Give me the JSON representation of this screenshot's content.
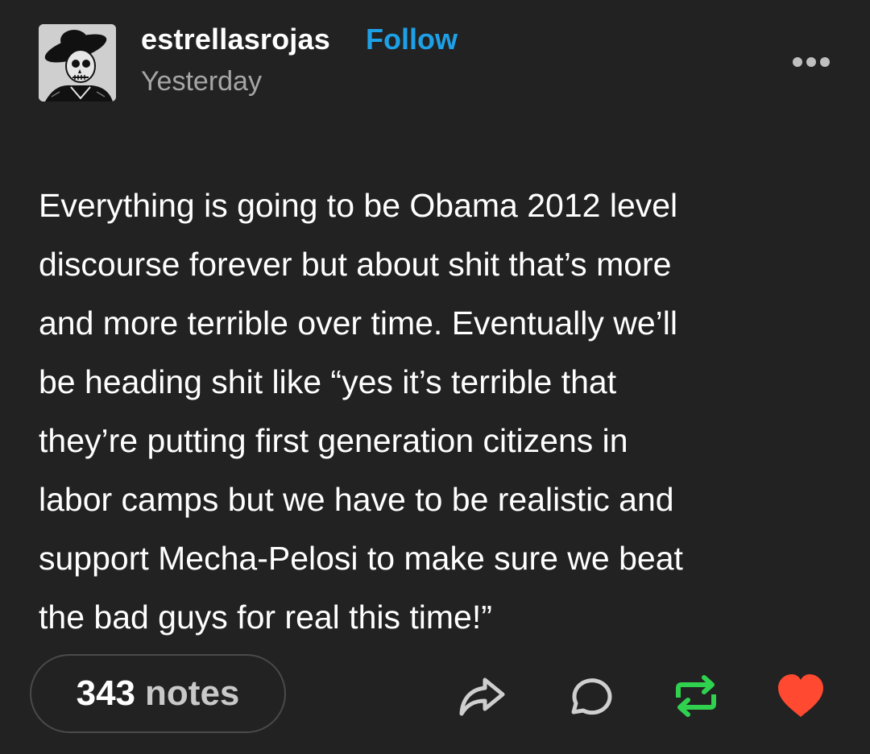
{
  "post": {
    "username": "estrellasrojas",
    "follow_label": "Follow",
    "timestamp": "Yesterday",
    "more_icon": "more-horizontal-icon",
    "body_lines": [
      "Everything is going to be Obama 2012 level",
      "discourse forever but about shit that’s more",
      "and more terrible over time. Eventually we’ll",
      "be heading shit like “yes it’s terrible that",
      "they’re putting first generation citizens in",
      "labor camps but we have to be realistic and",
      "support Mecha-Pelosi to make sure we beat",
      "the bad guys for real this time!”"
    ]
  },
  "footer": {
    "notes_count": "343",
    "notes_label": "notes",
    "actions": {
      "share": "share-icon",
      "reply": "reply-icon",
      "reblog": "reblog-icon",
      "like": "heart-icon"
    }
  },
  "colors": {
    "background": "#222222",
    "follow": "#1ea0e6",
    "timestamp": "#a6a6a6",
    "reblog": "#2fd14e",
    "like": "#ff4930"
  }
}
